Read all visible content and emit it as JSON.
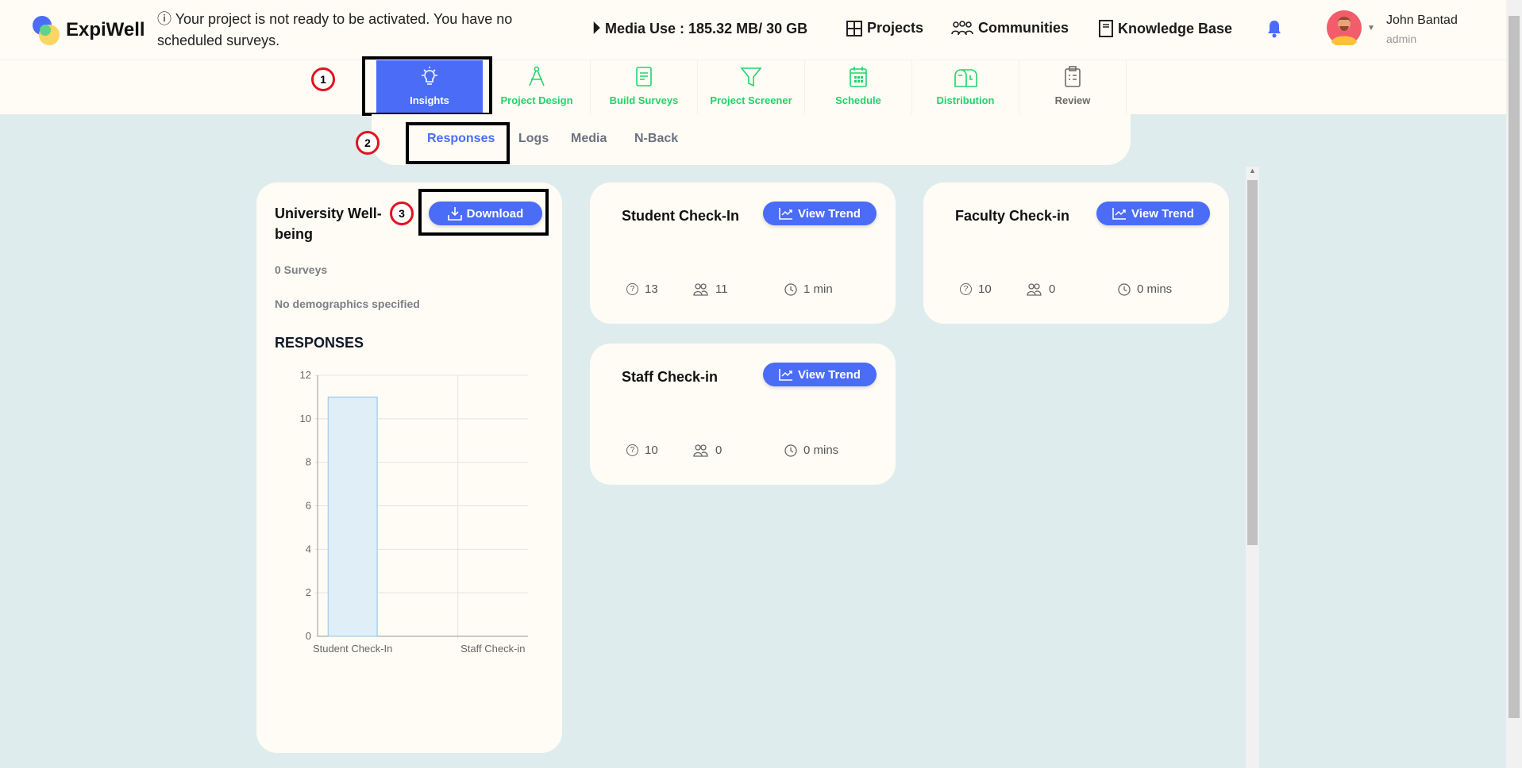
{
  "header": {
    "brand": "ExpiWell",
    "notice": "Your project is not ready to be activated. You have no scheduled surveys.",
    "media_use": "Media Use : 185.32 MB/ 30 GB",
    "projects": "Projects",
    "communities": "Communities",
    "knowledge_base": "Knowledge Base",
    "user_name": "John Bantad",
    "user_role": "admin"
  },
  "nav": {
    "tabs": [
      {
        "label": "Insights",
        "icon": "lightbulb-icon"
      },
      {
        "label": "Project Design",
        "icon": "compass-icon"
      },
      {
        "label": "Build Surveys",
        "icon": "document-icon"
      },
      {
        "label": "Project Screener",
        "icon": "filter-icon"
      },
      {
        "label": "Schedule",
        "icon": "calendar-icon"
      },
      {
        "label": "Distribution",
        "icon": "mailbox-icon"
      },
      {
        "label": "Review",
        "icon": "clipboard-icon"
      }
    ]
  },
  "subnav": {
    "tabs": [
      "Responses",
      "Logs",
      "Media",
      "N-Back"
    ]
  },
  "annotations": [
    "1",
    "2",
    "3"
  ],
  "project": {
    "title": "University Well-being",
    "download": "Download",
    "surveys": "0 Surveys",
    "demographics": "No demographics specified",
    "responses_heading": "RESPONSES"
  },
  "surveys": [
    {
      "title": "Student Check-In",
      "button": "View Trend",
      "questions": "13",
      "participants": "11",
      "duration": "1 min"
    },
    {
      "title": "Faculty Check-in",
      "button": "View Trend",
      "questions": "10",
      "participants": "0",
      "duration": "0 mins"
    },
    {
      "title": "Staff Check-in",
      "button": "View Trend",
      "questions": "10",
      "participants": "0",
      "duration": "0 mins"
    }
  ],
  "colors": {
    "accent": "#4a6cf7",
    "green": "#22d36a",
    "background": "#deecee",
    "card": "#fefcf4"
  },
  "chart_data": {
    "type": "bar",
    "categories": [
      "Student Check-In",
      "",
      "Staff Check-in"
    ],
    "values": [
      11,
      0,
      0
    ],
    "yticks": [
      "0",
      "2",
      "4",
      "6",
      "8",
      "10",
      "12"
    ],
    "ylim": [
      0,
      12
    ],
    "grid": true
  }
}
